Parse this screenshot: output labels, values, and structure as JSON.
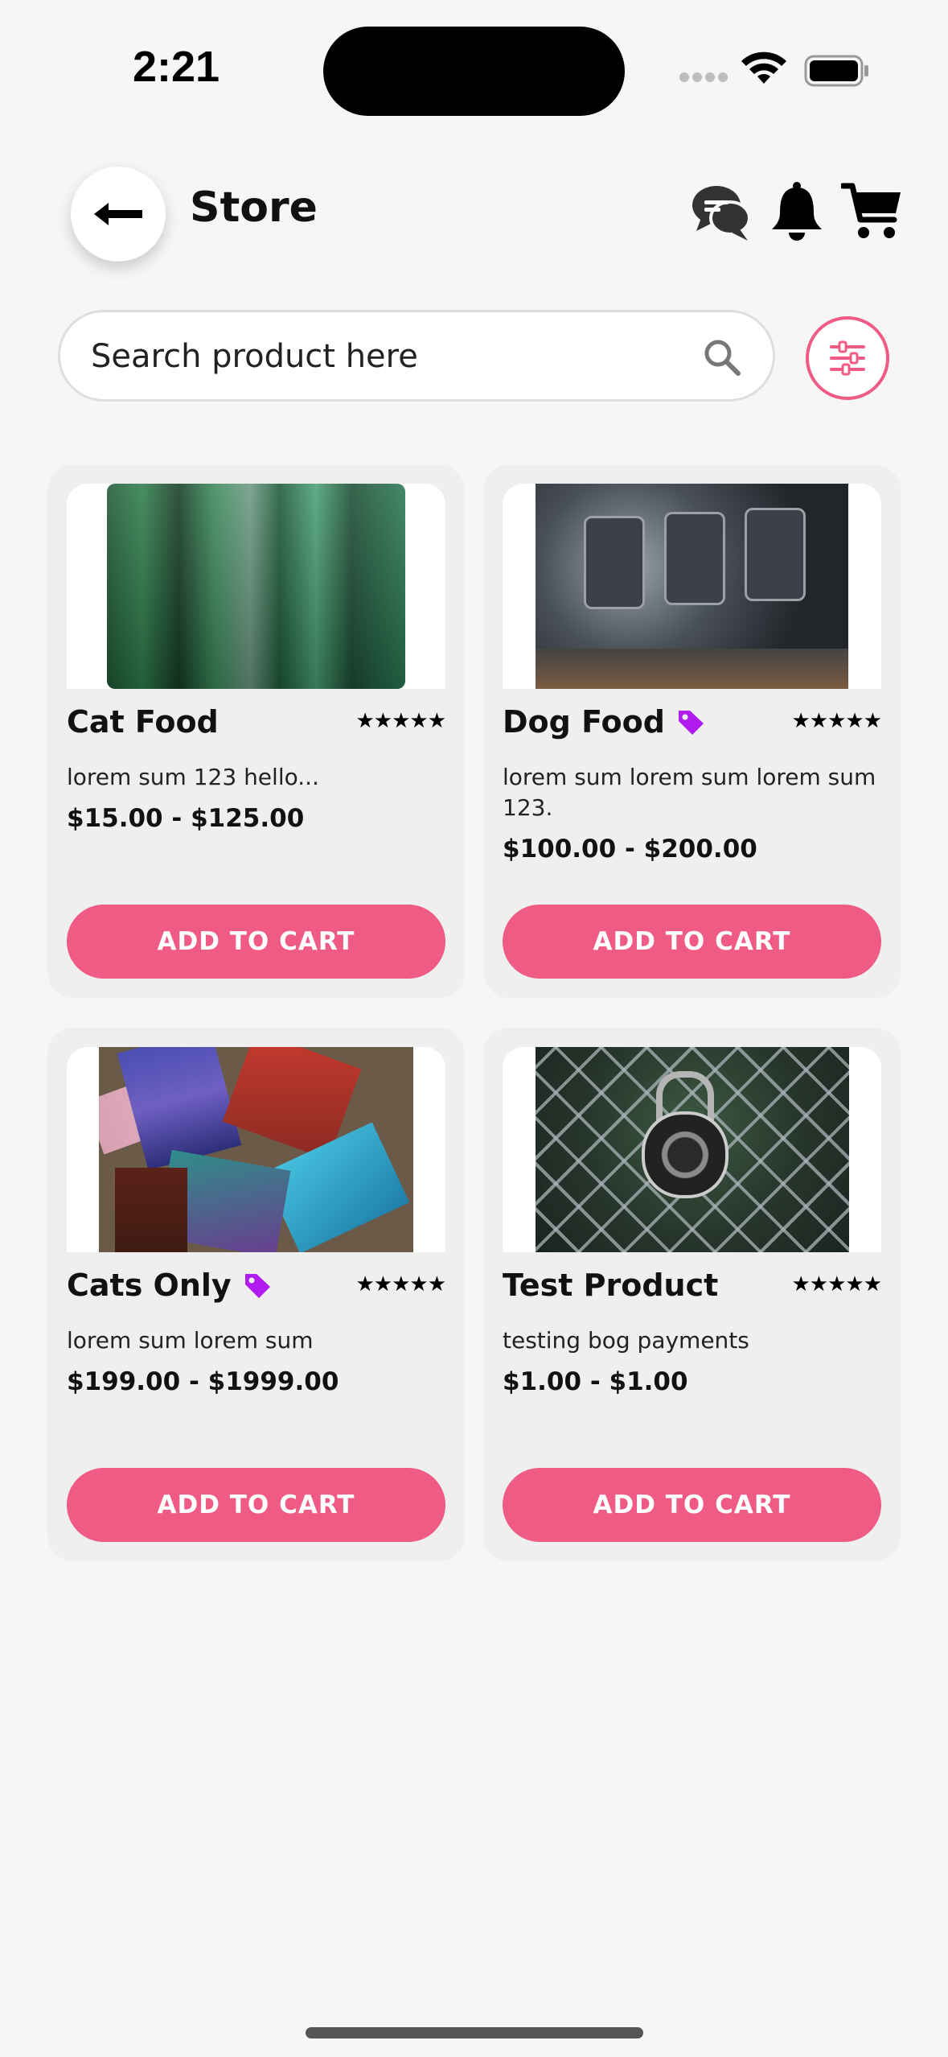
{
  "status_bar": {
    "time": "2:21"
  },
  "header": {
    "title": "Store",
    "icons": [
      "back-arrow-icon",
      "chat-icon",
      "bell-icon",
      "cart-icon"
    ]
  },
  "search": {
    "placeholder": "Search product here",
    "value": ""
  },
  "colors": {
    "accent": "#ef5b84",
    "tag": "#b01cf0",
    "card_bg": "#efefef",
    "page_bg": "#f6f6f6"
  },
  "products": [
    {
      "title": "Cat Food",
      "rating": "★★★★★",
      "has_tag": false,
      "description": "lorem sum 123 hello...",
      "price": "$15.00 - $125.00",
      "button": "ADD TO CART"
    },
    {
      "title": "Dog Food",
      "rating": "★★★★★",
      "has_tag": true,
      "description": "lorem sum lorem sum lorem sum 123.",
      "price": "$100.00 - $200.00",
      "button": "ADD TO CART"
    },
    {
      "title": "Cats Only",
      "rating": "★★★★★",
      "has_tag": true,
      "description": "lorem sum lorem sum",
      "price": "$199.00 - $1999.00",
      "button": "ADD TO CART"
    },
    {
      "title": "Test Product",
      "rating": "★★★★★",
      "has_tag": false,
      "description": "testing bog payments",
      "price": "$1.00 - $1.00",
      "button": "ADD TO CART"
    }
  ]
}
